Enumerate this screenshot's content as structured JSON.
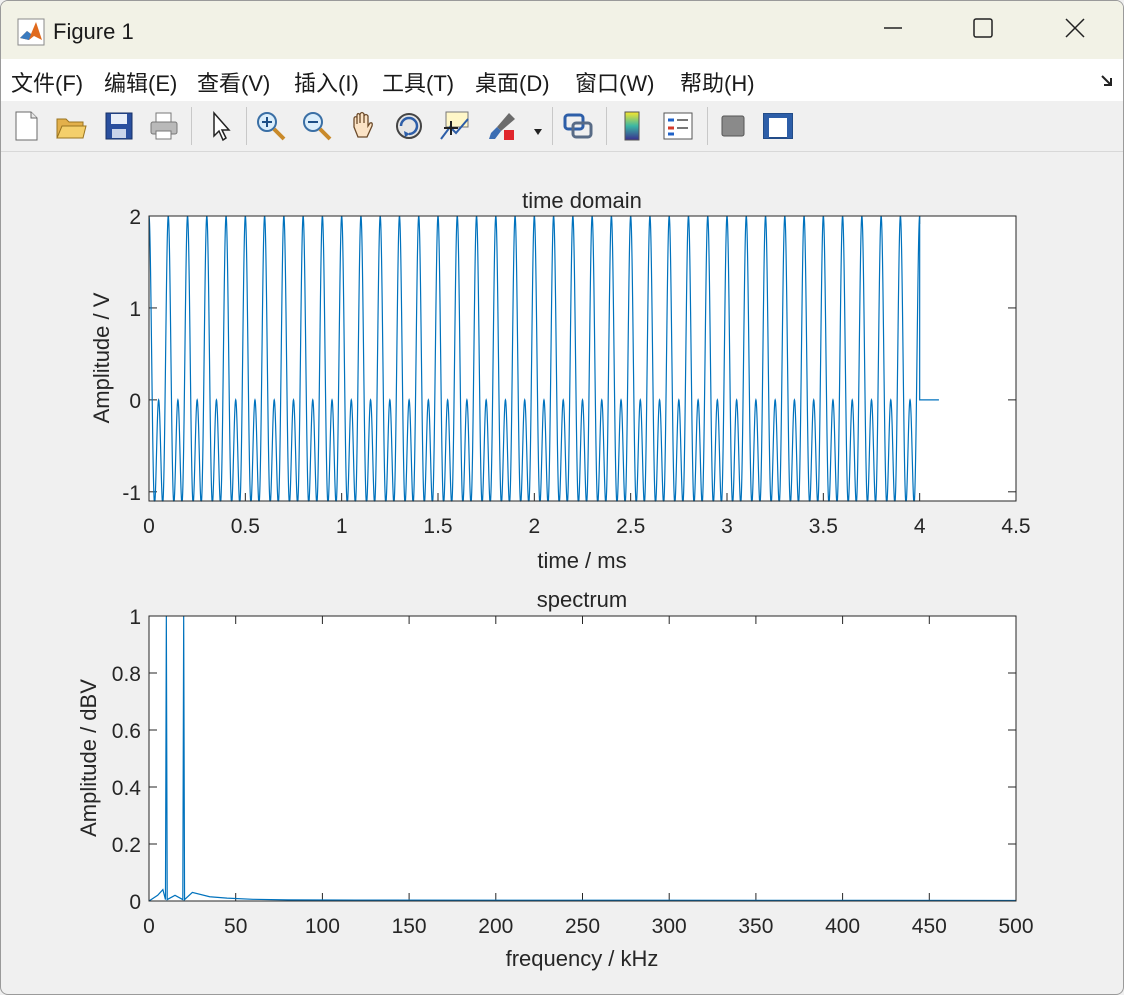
{
  "window": {
    "title": "Figure 1"
  },
  "menu": [
    {
      "label": "文件(F)"
    },
    {
      "label": "编辑(E)"
    },
    {
      "label": "查看(V)"
    },
    {
      "label": "插入(I)"
    },
    {
      "label": "工具(T)"
    },
    {
      "label": "桌面(D)"
    },
    {
      "label": "窗口(W)"
    },
    {
      "label": "帮助(H)"
    }
  ],
  "toolbar": [
    "new-figure-icon",
    "open-icon",
    "save-icon",
    "print-icon",
    "edit-plot-icon",
    "zoom-in-icon",
    "zoom-out-icon",
    "pan-icon",
    "rotate-3d-icon",
    "data-cursor-icon",
    "brush-icon",
    "link-plot-icon",
    "colorbar-icon",
    "legend-icon",
    "hide-plot-tools-icon",
    "show-plot-tools-icon"
  ],
  "colors": {
    "line": "#0072bd",
    "axes": "#262626",
    "figure_bg": "#f0f0f0"
  },
  "chart_data": [
    {
      "type": "line",
      "title": "time domain",
      "xlabel": "time / ms",
      "ylabel": "Amplitude / V",
      "xlim": [
        0,
        4.5
      ],
      "ylim": [
        -1.1,
        2
      ],
      "xticks": [
        "0",
        "0.5",
        "1",
        "1.5",
        "2",
        "2.5",
        "3",
        "3.5",
        "4",
        "4.5"
      ],
      "yticks": [
        "-1",
        "0",
        "1",
        "2"
      ],
      "grid": false,
      "series": [
        {
          "signal": "cos(2*pi*10*t) + cos(2*pi*20*t)",
          "t_range_ms": [
            0,
            4
          ],
          "tail_zero_range_ms": [
            4,
            4.1
          ],
          "components_khz": [
            10,
            20
          ],
          "component_amplitude_v": [
            1,
            1
          ]
        }
      ]
    },
    {
      "type": "line",
      "title": "spectrum",
      "xlabel": "frequency / kHz",
      "ylabel": "Amplitude / dBV",
      "xlim": [
        0,
        500
      ],
      "ylim": [
        0,
        1
      ],
      "xticks": [
        "0",
        "50",
        "100",
        "150",
        "200",
        "250",
        "300",
        "350",
        "400",
        "450",
        "500"
      ],
      "yticks": [
        "0",
        "0.2",
        "0.4",
        "0.6",
        "0.8",
        "1"
      ],
      "grid": false,
      "series": [
        {
          "peaks": [
            {
              "x": 10,
              "y": 1
            },
            {
              "x": 20,
              "y": 1
            }
          ],
          "sidelobes": [
            {
              "x": 5,
              "y": 0.02
            },
            {
              "x": 8,
              "y": 0.04
            },
            {
              "x": 15,
              "y": 0.02
            },
            {
              "x": 25,
              "y": 0.03
            },
            {
              "x": 35,
              "y": 0.015
            },
            {
              "x": 45,
              "y": 0.01
            },
            {
              "x": 60,
              "y": 0.006
            },
            {
              "x": 80,
              "y": 0.004
            },
            {
              "x": 120,
              "y": 0.003
            },
            {
              "x": 500,
              "y": 0.002
            }
          ]
        }
      ]
    }
  ]
}
